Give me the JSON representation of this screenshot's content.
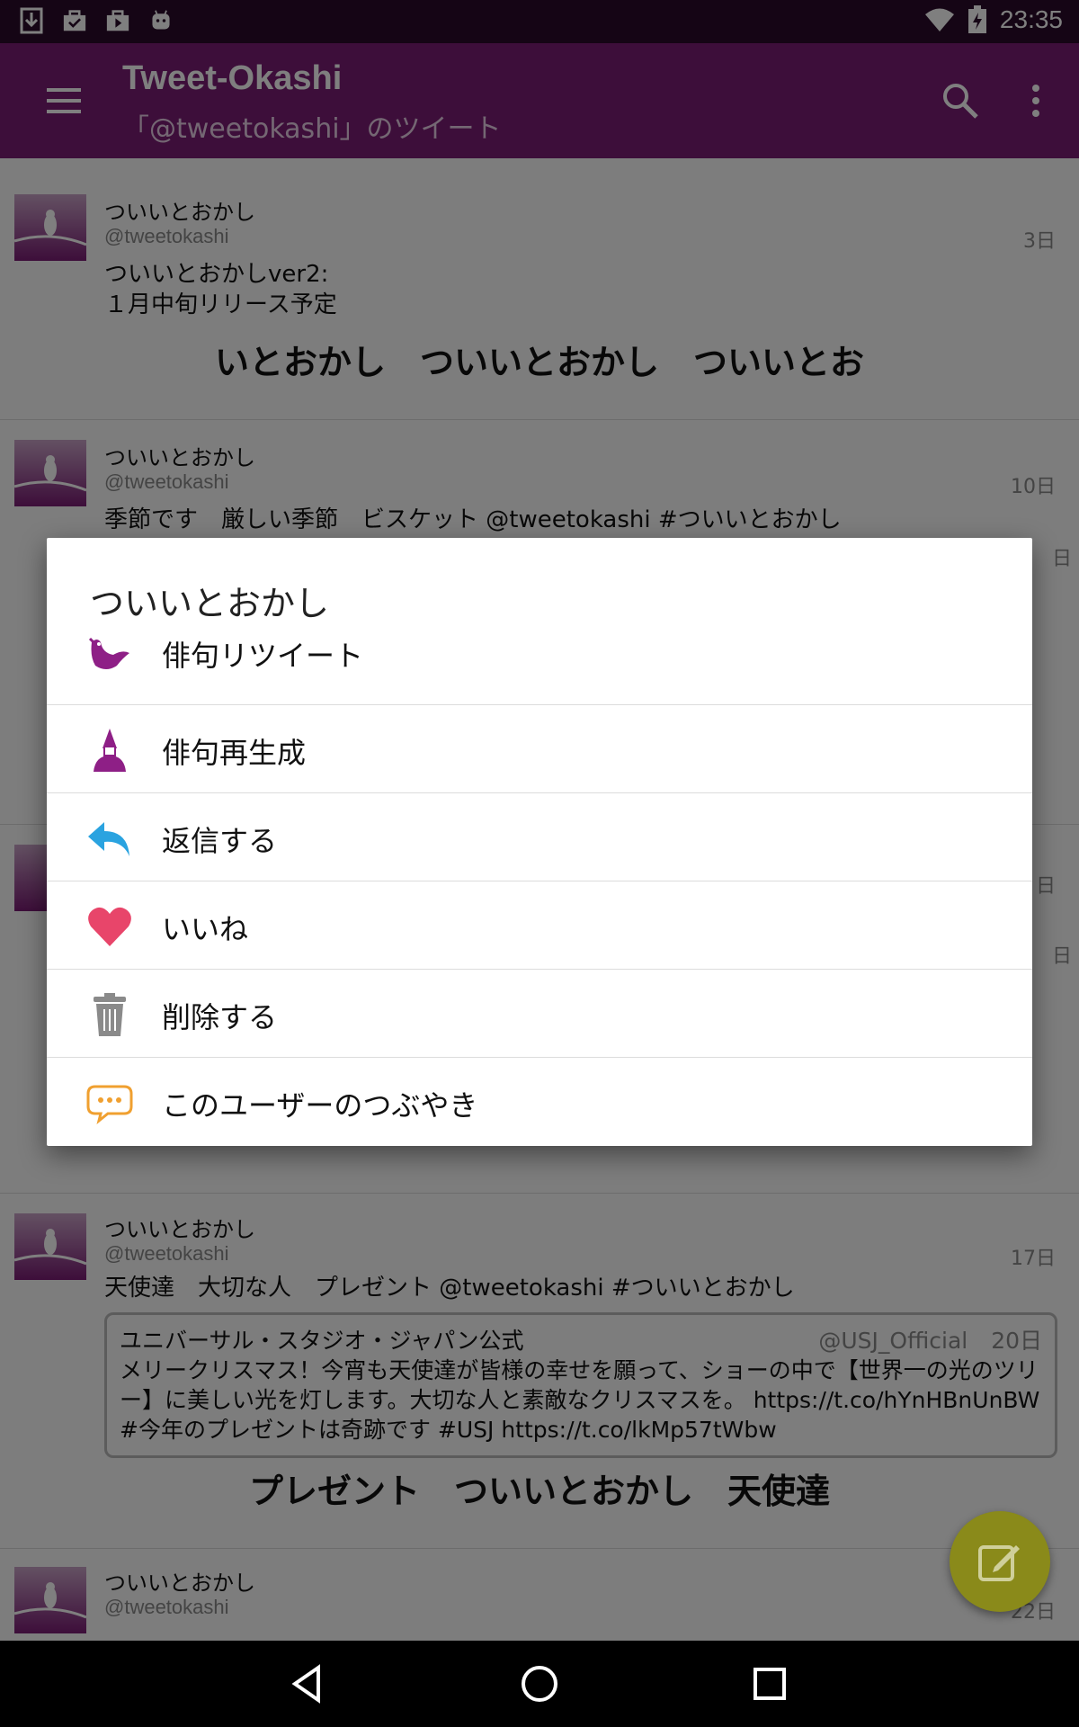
{
  "status_bar": {
    "time": "23:35",
    "left_icons": [
      "download-icon",
      "briefcase-check-icon",
      "briefcase-play-icon",
      "android-icon"
    ],
    "right_icons": [
      "wifi-icon",
      "battery-charging-icon"
    ]
  },
  "toolbar": {
    "title": "Tweet-Okashi",
    "subtitle": "「@tweetokashi」のツイート",
    "background": "#7a1c74"
  },
  "tweets": [
    {
      "name": "ついいとおかし",
      "handle": "@tweetokashi",
      "date": "3日",
      "text": "ついいとおかしver2:\n１月中旬リリース予定",
      "haiku": "いとおかし　ついいとおかし　ついいとお"
    },
    {
      "name": "ついいとおかし",
      "handle": "@tweetokashi",
      "date": "10日",
      "text": "季節です　厳しい季節　ビスケット @tweetokashi #ついいとおかし"
    },
    {
      "name": "ついいとおかし",
      "handle": "@tweetokashi",
      "date": "17日",
      "text": "天使達　大切な人　プレゼント @tweetokashi #ついいとおかし",
      "quote": {
        "name": "ユニバーサル・スタジオ・ジャパン公式",
        "handle": "@USJ_Official",
        "date": "20日",
        "text": "メリークリスマス！今宵も天使達が皆様の幸せを願って、ショーの中で【世界一の光のツリー】に美しい光を灯します。大切な人と素敵なクリスマスを。 https://t.co/hYnHBnUnBW #今年のプレゼントは奇跡です #USJ https://t.co/lkMp57tWbw"
      },
      "haiku": "プレゼント　ついいとおかし　天使達"
    },
    {
      "name": "ついいとおかし",
      "handle": "@tweetokashi",
      "date": "22日"
    }
  ],
  "hidden_dates": [
    "日",
    "日",
    "日"
  ],
  "dialog": {
    "title": "ついいとおかし",
    "items": [
      {
        "label": "俳句リツイート",
        "icon": "bird-icon",
        "color": "#8e1f86"
      },
      {
        "label": "俳句再生成",
        "icon": "poet-icon",
        "color": "#8e1f86"
      },
      {
        "label": "返信する",
        "icon": "reply-icon",
        "color": "#2aa3e0"
      },
      {
        "label": "いいね",
        "icon": "heart-icon",
        "color": "#e8456a"
      },
      {
        "label": "削除する",
        "icon": "trash-icon",
        "color": "#8a8a8a"
      },
      {
        "label": "このユーザーのつぶやき",
        "icon": "chat-bubble-icon",
        "color": "#f0a030"
      }
    ]
  },
  "fab": {
    "icon": "compose-icon",
    "color": "#8a8a1a"
  },
  "nav_bar": {
    "icons": [
      "back-icon",
      "home-icon",
      "recents-icon"
    ]
  }
}
